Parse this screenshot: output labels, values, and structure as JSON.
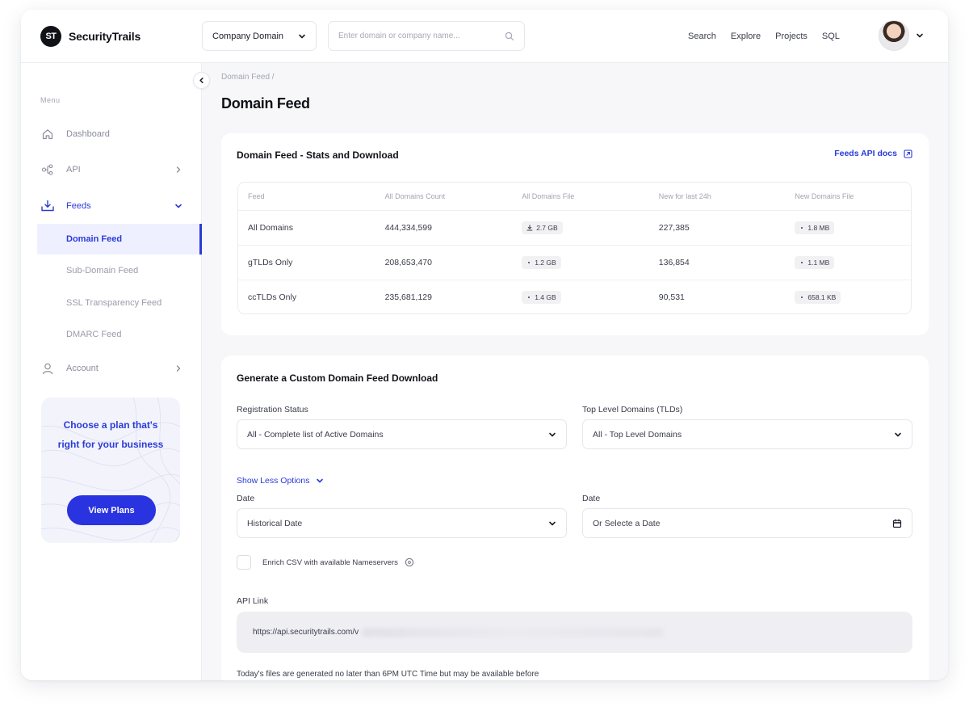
{
  "app": {
    "logo_mark": "ST",
    "brand": "SecurityTrails"
  },
  "header": {
    "search_type": "Company Domain",
    "search_placeholder": "Enter domain or company name...",
    "nav": [
      "Search",
      "Explore",
      "Projects",
      "SQL"
    ]
  },
  "sidebar": {
    "menu_label": "Menu",
    "items": [
      {
        "label": "Dashboard",
        "icon": "home-icon"
      },
      {
        "label": "API",
        "icon": "api-nodes-icon"
      },
      {
        "label": "Feeds",
        "icon": "download-tray-icon"
      },
      {
        "label": "Account",
        "icon": "user-icon"
      }
    ],
    "feeds_sub": [
      "Domain Feed",
      "Sub-Domain Feed",
      "SSL Transparency Feed",
      "DMARC Feed"
    ],
    "plan_card": {
      "title": "Choose a plan that's right for your business",
      "button": "View Plans"
    }
  },
  "page": {
    "breadcrumb": "Domain Feed /",
    "title": "Domain Feed"
  },
  "stats": {
    "title": "Domain Feed - Stats and Download",
    "api_docs_link": "Feeds API docs",
    "columns": [
      "Feed",
      "All Domains Count",
      "All Domains File",
      "New for last 24h",
      "New Domains File"
    ],
    "rows": [
      {
        "feed": "All Domains",
        "count": "444,334,599",
        "file": "2.7 GB",
        "new": "227,385",
        "new_file": "1.8 MB"
      },
      {
        "feed": "gTLDs Only",
        "count": "208,653,470",
        "file": "1.2 GB",
        "new": "136,854",
        "new_file": "1.1 MB"
      },
      {
        "feed": "ccTLDs Only",
        "count": "235,681,129",
        "file": "1.4 GB",
        "new": "90,531",
        "new_file": "658.1 KB"
      }
    ]
  },
  "custom": {
    "title": "Generate a Custom Domain Feed Download",
    "registration_label": "Registration Status",
    "registration_value": "All - Complete list of Active Domains",
    "tld_label": "Top Level Domains (TLDs)",
    "tld_value": "All - Top Level Domains",
    "show_less": "Show Less Options",
    "date_label_1": "Date",
    "date_value_1": "Historical Date",
    "date_label_2": "Date",
    "date_placeholder_2": "Or Selecte a Date",
    "enrich_label": "Enrich CSV with available Nameservers",
    "api_label": "API Link",
    "api_value": "https://api.securitytrails.com/v",
    "note": "Today's files are generated no later than 6PM UTC Time but may be available before"
  },
  "colors": {
    "accent": "#2a3bd8",
    "button": "#2a33e0",
    "text": "#1a1d29"
  }
}
